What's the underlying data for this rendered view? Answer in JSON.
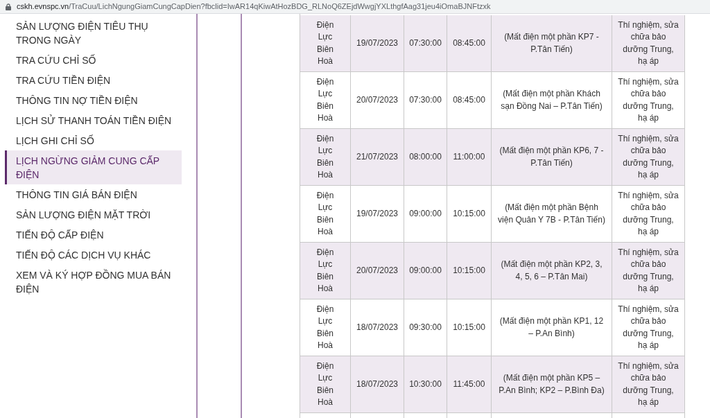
{
  "address_bar": {
    "url_host": "cskh.evnspc.vn",
    "url_path": "/TraCuu/LichNgungGiamCungCapDien?fbclid=IwAR14qKiwAtHozBDG_RLNoQ6ZEjdWwgjYXLthgfAag31jeu4iOmaBJNFtzxk"
  },
  "sidebar": {
    "items": [
      {
        "label": "SẢN LƯỢNG ĐIỆN TIÊU THỤ TRONG NGÀY",
        "selected": false
      },
      {
        "label": "TRA CỨU CHỈ SỐ",
        "selected": false
      },
      {
        "label": "TRA CỨU TIỀN ĐIỆN",
        "selected": false
      },
      {
        "label": "THÔNG TIN NỢ TIỀN ĐIỆN",
        "selected": false
      },
      {
        "label": "LỊCH SỬ THANH TOÁN TIỀN ĐIỆN",
        "selected": false
      },
      {
        "label": "LỊCH GHI CHỈ SỐ",
        "selected": false
      },
      {
        "label": "LỊCH NGỪNG GIẢM CUNG CẤP ĐIỆN",
        "selected": true
      },
      {
        "label": "THÔNG TIN GIÁ BÁN ĐIỆN",
        "selected": false
      },
      {
        "label": "SẢN LƯỢNG ĐIỆN MẶT TRỜI",
        "selected": false
      },
      {
        "label": "TIẾN ĐỘ CẤP ĐIỆN",
        "selected": false
      },
      {
        "label": "TIẾN ĐỘ CÁC DỊCH VỤ KHÁC",
        "selected": false
      },
      {
        "label": "XEM VÀ KÝ HỢP ĐỒNG MUA BÁN ĐIỆN",
        "selected": false
      }
    ]
  },
  "table": {
    "rows": [
      {
        "unit": "Điện Lực Biên Hoà",
        "date": "19/07/2023",
        "start": "07:30:00",
        "end": "08:45:00",
        "area": "(Mất điện một phần KP7 - P.Tân Tiến)",
        "reason": "Thí nghiệm, sửa chữa bảo dưỡng Trung, hạ áp"
      },
      {
        "unit": "Điện Lực Biên Hoà",
        "date": "20/07/2023",
        "start": "07:30:00",
        "end": "08:45:00",
        "area": "(Mất điện một phần Khách sạn Đồng Nai – P.Tân Tiến)",
        "reason": "Thí nghiệm, sửa chữa bảo dưỡng Trung, hạ áp"
      },
      {
        "unit": "Điện Lực Biên Hoà",
        "date": "21/07/2023",
        "start": "08:00:00",
        "end": "11:00:00",
        "area": "(Mất điện một phần KP6, 7 - P.Tân Tiến)",
        "reason": "Thí nghiệm, sửa chữa bảo dưỡng Trung, hạ áp"
      },
      {
        "unit": "Điện Lực Biên Hoà",
        "date": "19/07/2023",
        "start": "09:00:00",
        "end": "10:15:00",
        "area": "(Mất điện một phần Bệnh viện Quân Y 7B - P.Tân Tiến)",
        "reason": "Thí nghiệm, sửa chữa bảo dưỡng Trung, hạ áp"
      },
      {
        "unit": "Điện Lực Biên Hoà",
        "date": "20/07/2023",
        "start": "09:00:00",
        "end": "10:15:00",
        "area": "(Mất điện một phần KP2, 3, 4, 5, 6 – P.Tân Mai)",
        "reason": "Thí nghiệm, sửa chữa bảo dưỡng Trung, hạ áp"
      },
      {
        "unit": "Điện Lực Biên Hoà",
        "date": "18/07/2023",
        "start": "09:30:00",
        "end": "10:15:00",
        "area": "(Mất điện một phần KP1, 12 – P.An Bình)",
        "reason": "Thí nghiệm, sửa chữa bảo dưỡng Trung, hạ áp"
      },
      {
        "unit": "Điện Lực Biên Hoà",
        "date": "18/07/2023",
        "start": "10:30:00",
        "end": "11:45:00",
        "area": "(Mất điện một phần KP5 – P.An Bình; KP2 – P.Bình Đa)",
        "reason": "Thí nghiệm, sửa chữa bảo dưỡng Trung, hạ áp"
      }
    ]
  }
}
